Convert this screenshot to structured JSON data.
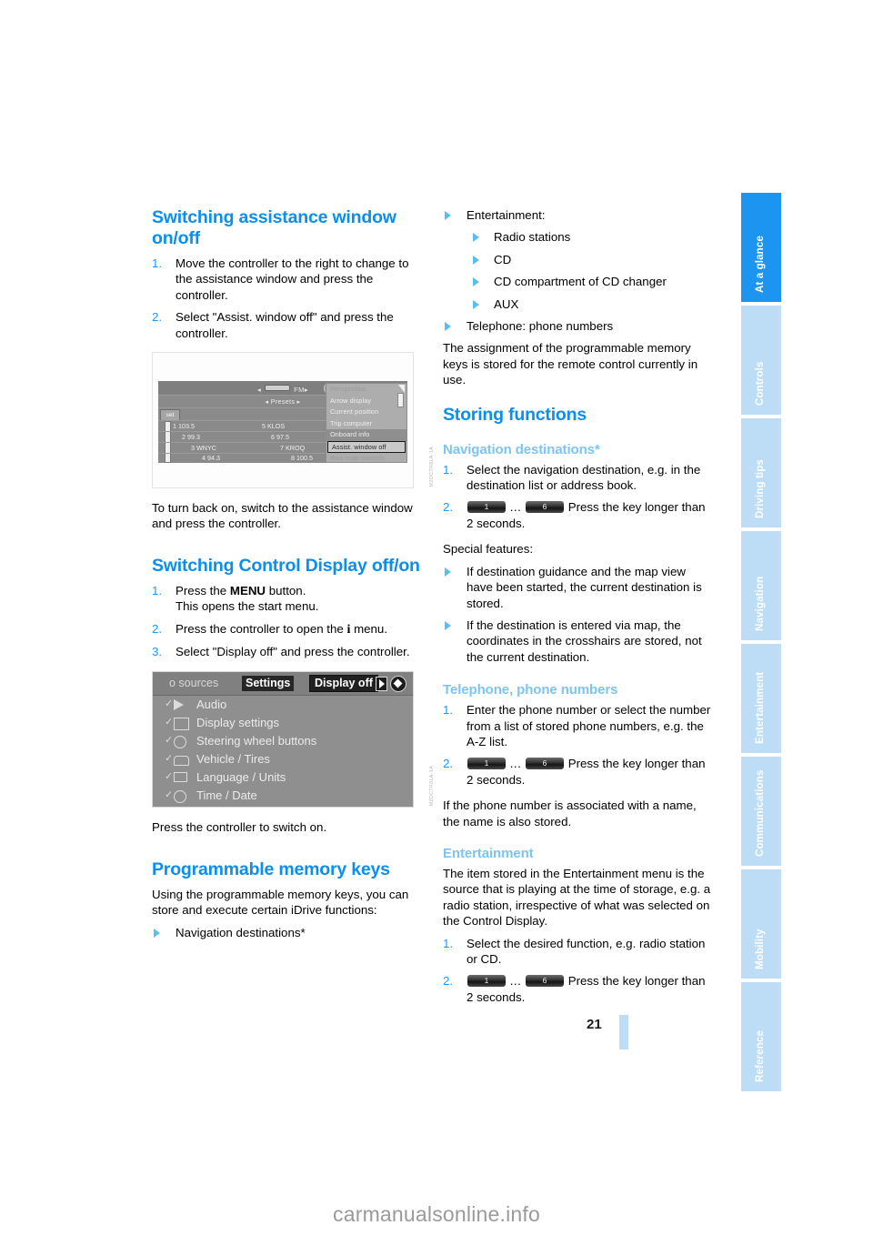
{
  "page": {
    "number": "21",
    "watermark": "carmanualsonline.info"
  },
  "sidebar": {
    "tabs": [
      {
        "label": "At a glance",
        "active": true
      },
      {
        "label": "Controls",
        "active": false
      },
      {
        "label": "Driving tips",
        "active": false
      },
      {
        "label": "Navigation",
        "active": false
      },
      {
        "label": "Entertainment",
        "active": false
      },
      {
        "label": "Communications",
        "active": false
      },
      {
        "label": "Mobility",
        "active": false
      },
      {
        "label": "Reference",
        "active": false
      }
    ]
  },
  "left_column": {
    "heading_1": "Switching assistance window on/off",
    "steps_1": [
      {
        "num": "1.",
        "text": "Move the controller to the right to change to the assistance window and press the controller."
      },
      {
        "num": "2.",
        "text": "Select \"Assist. window off\" and press the controller."
      }
    ],
    "figure_1": {
      "caption_vertical": "MZDCTR6LA-1A",
      "band_label": "FM",
      "presets_label": "Presets",
      "set_button": "set",
      "preset_rows": [
        {
          "left": "1 103.5",
          "right": "5 KLOS"
        },
        {
          "left": "2 99.3",
          "right": "6 97.5"
        },
        {
          "left": "3 WNYC",
          "right": "7 KROQ"
        },
        {
          "left": "4 94.3",
          "right": "8 100.5"
        }
      ],
      "menu_items": [
        {
          "label": "Perspective",
          "state": "faint"
        },
        {
          "label": "Arrow display",
          "state": "normal"
        },
        {
          "label": "Current position",
          "state": "normal"
        },
        {
          "label": "Trip computer",
          "state": "normal"
        },
        {
          "label": "Onboard info",
          "state": "selected"
        },
        {
          "label": "Assist. window off",
          "state": "boxed"
        },
        {
          "label": "Raw map controls",
          "state": "faint"
        }
      ]
    },
    "paragraph_1": "To turn back on, switch to the assistance window and press the controller.",
    "heading_2": "Switching Control Display off/on",
    "steps_2": [
      {
        "num": "1.",
        "pre": "Press the ",
        "bold": "MENU",
        "post": " button.",
        "second_line": "This opens the start menu."
      },
      {
        "num": "2.",
        "pre": "Press the controller to open the ",
        "icon": "i",
        "post": " menu."
      },
      {
        "num": "3.",
        "text": "Select \"Display off\" and press the controller."
      }
    ],
    "figure_2": {
      "caption_vertical": "MZDCTR6LA-1A",
      "bar_items": [
        "o sources",
        "Settings",
        "Display off"
      ],
      "menu_items": [
        "Audio",
        "Display settings",
        "Steering wheel buttons",
        "Vehicle / Tires",
        "Language / Units",
        "Time / Date"
      ]
    },
    "paragraph_2": "Press the controller to switch on.",
    "heading_3": "Programmable memory keys",
    "paragraph_3": "Using the programmable memory keys, you can store and execute certain iDrive functions:",
    "bullet_1": "Navigation destinations*"
  },
  "right_column": {
    "bullet_entertainment": "Entertainment:",
    "sub_bullets": [
      "Radio stations",
      "CD",
      "CD compartment of CD changer",
      "AUX"
    ],
    "bullet_telephone": "Telephone: phone numbers",
    "paragraph_1": "The assignment of the programmable memory keys is stored for the remote control currently in use.",
    "heading_storing": "Storing functions",
    "heading_nav": "Navigation destinations*",
    "nav_steps": [
      {
        "num": "1.",
        "text": "Select the navigation destination, e.g. in the destination list or address book."
      },
      {
        "num": "2.",
        "key_first": "1",
        "key_dots": "...",
        "key_last": "6",
        "text": "Press the key longer than 2 seconds."
      }
    ],
    "special_features_label": "Special features:",
    "special_bullets": [
      "If destination guidance and the map view have been started, the current destination is stored.",
      "If the destination is entered via map, the coordinates in the crosshairs are stored, not the current destination."
    ],
    "heading_phone": "Telephone, phone numbers",
    "phone_steps": [
      {
        "num": "1.",
        "text": "Enter the phone number or select the number from a list of stored phone numbers, e.g. the A-Z list."
      },
      {
        "num": "2.",
        "key_first": "1",
        "key_dots": "...",
        "key_last": "6",
        "text": "Press the key longer than 2 seconds."
      }
    ],
    "paragraph_2": "If the phone number is associated with a name, the name is also stored.",
    "heading_entertainment": "Entertainment",
    "paragraph_3": "The item stored in the Entertainment menu is the source that is playing at the time of storage, e.g. a radio station, irrespective of what was selected on the Control Display.",
    "ent_steps": [
      {
        "num": "1.",
        "text": "Select the desired function, e.g. radio station or CD."
      },
      {
        "num": "2.",
        "key_first": "1",
        "key_dots": "...",
        "key_last": "6",
        "text": "Press the key longer than 2 seconds."
      }
    ]
  },
  "colors": {
    "heading_blue": "#0a8ef0",
    "subheading_blue": "#7dc4f2",
    "tab_active": "#1c95f0",
    "tab_inactive": "#bddcf5"
  }
}
